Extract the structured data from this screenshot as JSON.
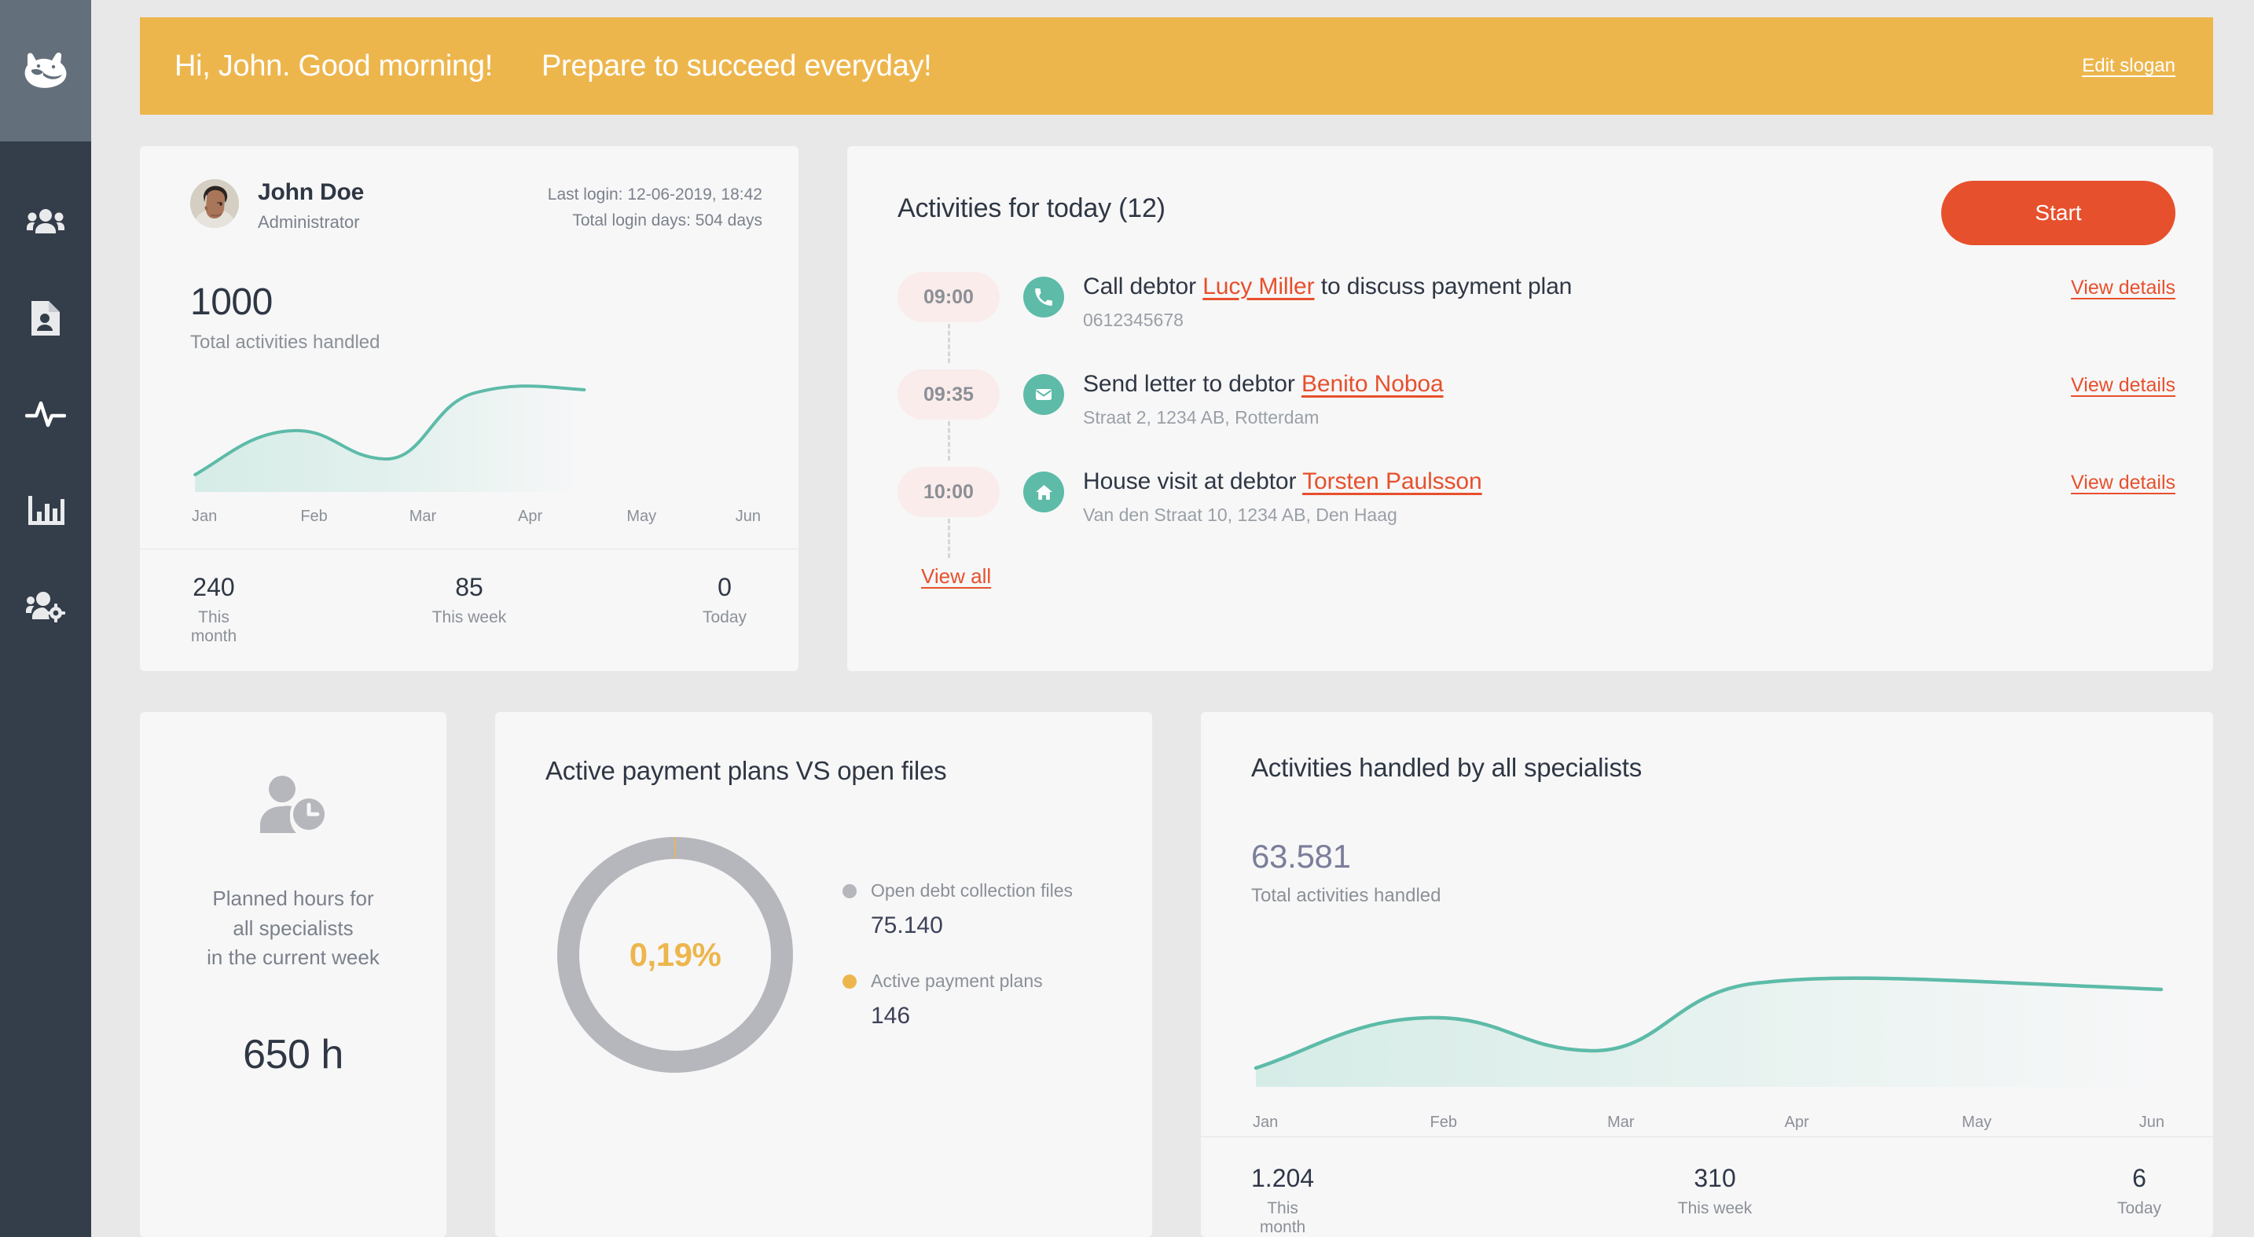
{
  "sidebar": {
    "logo_name": "cat-logo",
    "items": [
      {
        "icon": "users-group-icon",
        "name": "sidebar-item-customers"
      },
      {
        "icon": "document-person-icon",
        "name": "sidebar-item-files"
      },
      {
        "icon": "activity-pulse-icon",
        "name": "sidebar-item-activities"
      },
      {
        "icon": "bar-chart-icon",
        "name": "sidebar-item-reports"
      },
      {
        "icon": "users-settings-icon",
        "name": "sidebar-item-specialists"
      }
    ]
  },
  "banner": {
    "greeting": "Hi, John. Good morning!",
    "slogan": "Prepare to succeed everyday!",
    "edit_label": "Edit slogan",
    "bg_color": "#edb64d"
  },
  "profile": {
    "name": "John Doe",
    "role": "Administrator",
    "last_login": "Last login: 12-06-2019, 18:42",
    "total_login_days": "Total login days: 504 days",
    "total_value": "1000",
    "total_label": "Total activities handled",
    "stats": [
      {
        "value": "240",
        "label": "This month"
      },
      {
        "value": "85",
        "label": "This week"
      },
      {
        "value": "0",
        "label": "Today"
      }
    ]
  },
  "activities": {
    "title": "Activities for today (12)",
    "start_label": "Start",
    "view_all_label": "View all",
    "view_details_label": "View details",
    "items": [
      {
        "time": "09:00",
        "icon": "phone-icon",
        "text_before": "Call debtor ",
        "link": "Lucy Miller",
        "text_after": " to discuss payment plan",
        "sub": "0612345678"
      },
      {
        "time": "09:35",
        "icon": "envelope-icon",
        "text_before": "Send letter to debtor ",
        "link": "Benito Noboa",
        "text_after": "",
        "sub": "Straat 2, 1234 AB, Rotterdam"
      },
      {
        "time": "10:00",
        "icon": "home-icon",
        "text_before": "House visit at debtor ",
        "link": "Torsten Paulsson",
        "text_after": "",
        "sub": "Van den Straat 10, 1234 AB, Den Haag"
      }
    ]
  },
  "hours": {
    "icon": "person-clock-icon",
    "line1": "Planned hours for",
    "line2": "all specialists",
    "line3": "in the current week",
    "value": "650 h"
  },
  "donut": {
    "title": "Active payment plans VS open files",
    "center_value": "0,19%",
    "legend": [
      {
        "label": "Open debt collection files",
        "value": "75.140",
        "color": "#b6b7bc"
      },
      {
        "label": "Active payment plans",
        "value": "146",
        "color": "#edb64d"
      }
    ]
  },
  "specialists": {
    "title": "Activities handled by all specialists",
    "total_value": "63.581",
    "total_label": "Total activities handled",
    "stats": [
      {
        "value": "1.204",
        "label": "This month"
      },
      {
        "value": "310",
        "label": "This week"
      },
      {
        "value": "6",
        "label": "Today"
      }
    ]
  },
  "chart_data": [
    {
      "type": "area",
      "name": "profile-activities-sparkline",
      "title": "Total activities handled",
      "categories": [
        "Jan",
        "Feb",
        "Mar",
        "Apr",
        "May",
        "Jun"
      ],
      "values": [
        18,
        48,
        40,
        86,
        96,
        93
      ],
      "xlabel": "",
      "ylabel": "",
      "ylim": [
        0,
        100
      ],
      "grid": false,
      "legend": "none",
      "line_color": "#5dbba8",
      "fill_color": "#dbeeea"
    },
    {
      "type": "area",
      "name": "specialists-activities-sparkline",
      "title": "Activities handled by all specialists",
      "categories": [
        "Jan",
        "Feb",
        "Mar",
        "Apr",
        "May",
        "Jun"
      ],
      "values": [
        18,
        48,
        40,
        86,
        96,
        93
      ],
      "xlabel": "",
      "ylabel": "",
      "ylim": [
        0,
        100
      ],
      "grid": false,
      "legend": "none",
      "line_color": "#5dbba8",
      "fill_color": "#dbeeea"
    },
    {
      "type": "pie",
      "name": "payment-plans-donut",
      "title": "Active payment plans VS open files",
      "labels": [
        "Open debt collection files",
        "Active payment plans"
      ],
      "values": [
        75140,
        146
      ],
      "percentages": [
        99.81,
        0.19
      ],
      "colors": [
        "#b6b7bc",
        "#edb64d"
      ],
      "center_label": "0,19%",
      "legend": "right",
      "donut": true
    }
  ]
}
